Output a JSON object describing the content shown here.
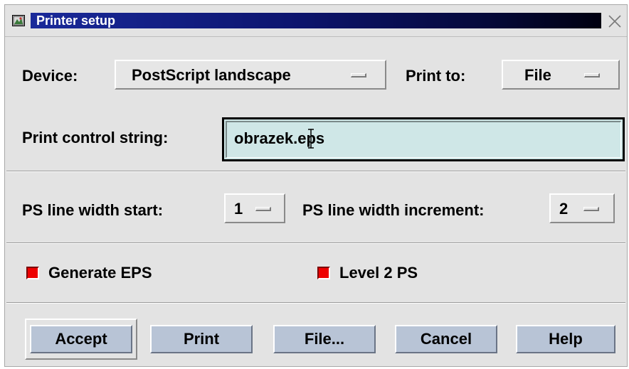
{
  "window": {
    "title": "Printer setup",
    "title_gradient": [
      "#1a2a9a",
      "#000010"
    ],
    "background": "#e3e3e3"
  },
  "device": {
    "label": "Device:",
    "value": "PostScript landscape"
  },
  "print_to": {
    "label": "Print to:",
    "value": "File"
  },
  "print_control": {
    "label": "Print control string:",
    "value": "obrazek.eps",
    "field_color": "#cfe7e7"
  },
  "line_width_start": {
    "label": "PS line width start:",
    "value": "1"
  },
  "line_width_increment": {
    "label": "PS line width increment:",
    "value": "2"
  },
  "options": {
    "generate_eps": {
      "label": "Generate EPS",
      "checked": true
    },
    "level2_ps": {
      "label": "Level 2 PS",
      "checked": true
    },
    "check_color": "#ee0000"
  },
  "buttons": {
    "accept": "Accept",
    "print": "Print",
    "file": "File...",
    "cancel": "Cancel",
    "help": "Help",
    "color": "#b8c4d6"
  },
  "icons": {
    "window_menu": "window-menu-icon",
    "close": "close-icon",
    "text_cursor": "i-beam-cursor-icon",
    "option_indicator": "option-menu-indicator-icon"
  }
}
